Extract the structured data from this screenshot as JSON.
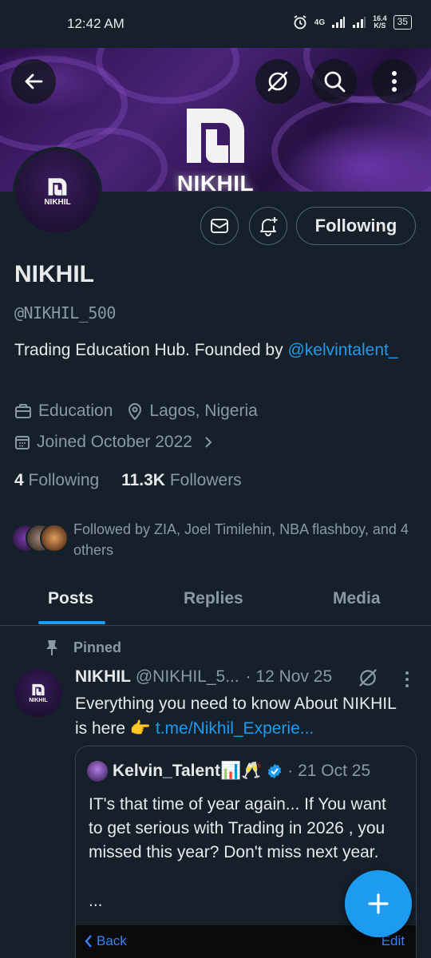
{
  "status": {
    "time": "12:42 AM",
    "network": "4G",
    "speed_value": "16.4",
    "speed_unit": "K/S",
    "battery": "35"
  },
  "banner": {
    "text": "NIKHIL"
  },
  "profile": {
    "avatar_text": "NIKHIL",
    "following_label": "Following",
    "name": "NIKHIL",
    "handle": "@NIKHIL_500",
    "bio_text": "Trading Education Hub.  Founded by",
    "bio_link": "@kelvintalent_",
    "category": "Education",
    "location": "Lagos, Nigeria",
    "joined": "Joined October 2022",
    "following_count": "4",
    "following_word": "Following",
    "followers_count": "11.3K",
    "followers_word": "Followers",
    "followed_by": "Followed by ZIA, Joel Timilehin, NBA flashboy, and 4 others"
  },
  "tabs": [
    "Posts",
    "Replies",
    "Media"
  ],
  "tweet": {
    "pinned_label": "Pinned",
    "avatar_text": "NIKHIL",
    "name": "NIKHIL",
    "handle": "@NIKHIL_5...",
    "date": "· 12 Nov 25",
    "text": "Everything you need to know About NIKHIL is here 👉 ",
    "link": "t.me/Nikhil_Experie...",
    "quote": {
      "name": "Kelvin_Talent📊🥂",
      "date": "· 21 Oct 25",
      "text": "IT's that time of year again... If You want to get serious with Trading in 2026 , you missed this year? Don't miss next year.",
      "ellipsis": "...",
      "image_back": "Back",
      "image_edit": "Edit"
    }
  },
  "colors": {
    "accent": "#1d9bf0",
    "background": "#15202b",
    "muted": "#8b98a5"
  }
}
